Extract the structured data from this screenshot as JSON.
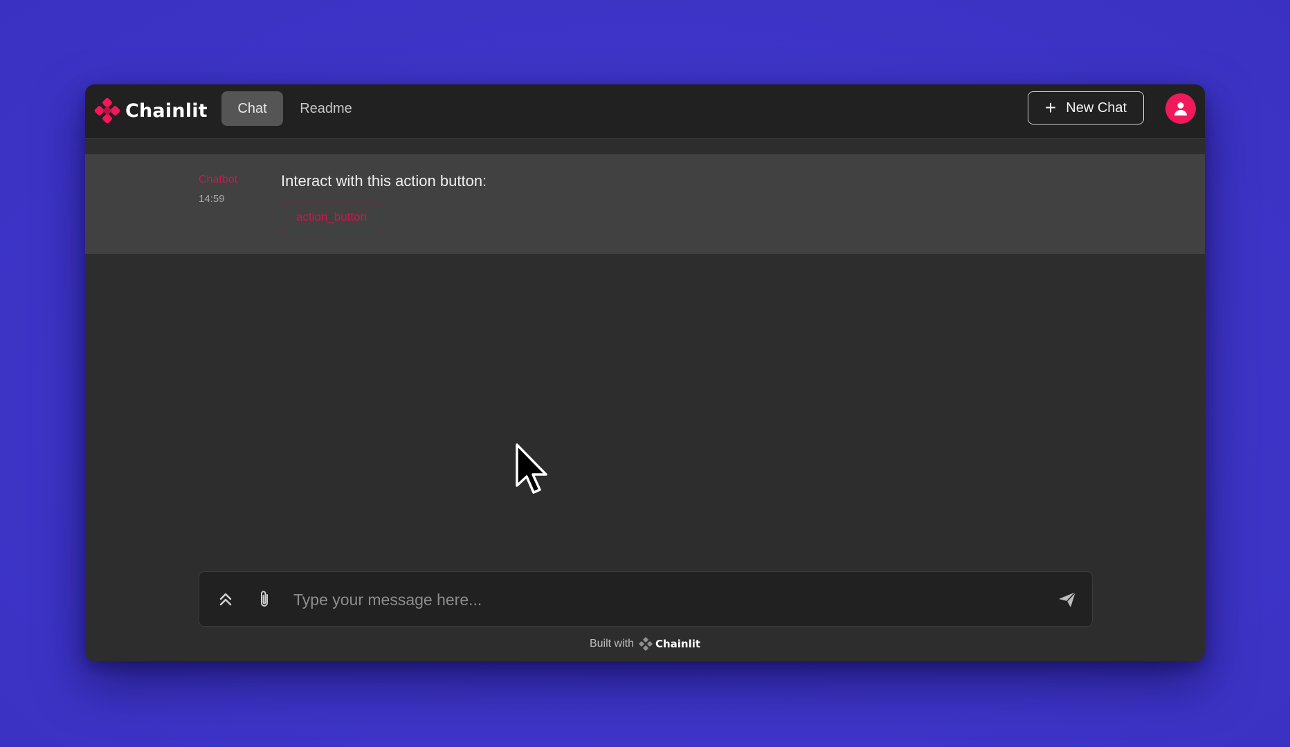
{
  "header": {
    "logo_text": "Chainlit",
    "tabs": [
      {
        "label": "Chat",
        "active": true
      },
      {
        "label": "Readme",
        "active": false
      }
    ],
    "new_chat_label": "New Chat"
  },
  "message": {
    "author": "Chatbot",
    "time": "14:59",
    "text": "Interact with this action button:",
    "action_label": "action_button"
  },
  "composer": {
    "placeholder": "Type your message here..."
  },
  "footer": {
    "built_with": "Built with",
    "brand": "Chainlit"
  },
  "colors": {
    "accent": "#f0195b",
    "background": "#3d34c6",
    "window": "#2d2d2d",
    "header": "#212121",
    "message_block": "#414141"
  },
  "icons": [
    "chainlit-logo-icon",
    "plus-icon",
    "user-icon",
    "chevrons-up-icon",
    "paperclip-icon",
    "send-icon",
    "mouse-cursor-icon"
  ]
}
